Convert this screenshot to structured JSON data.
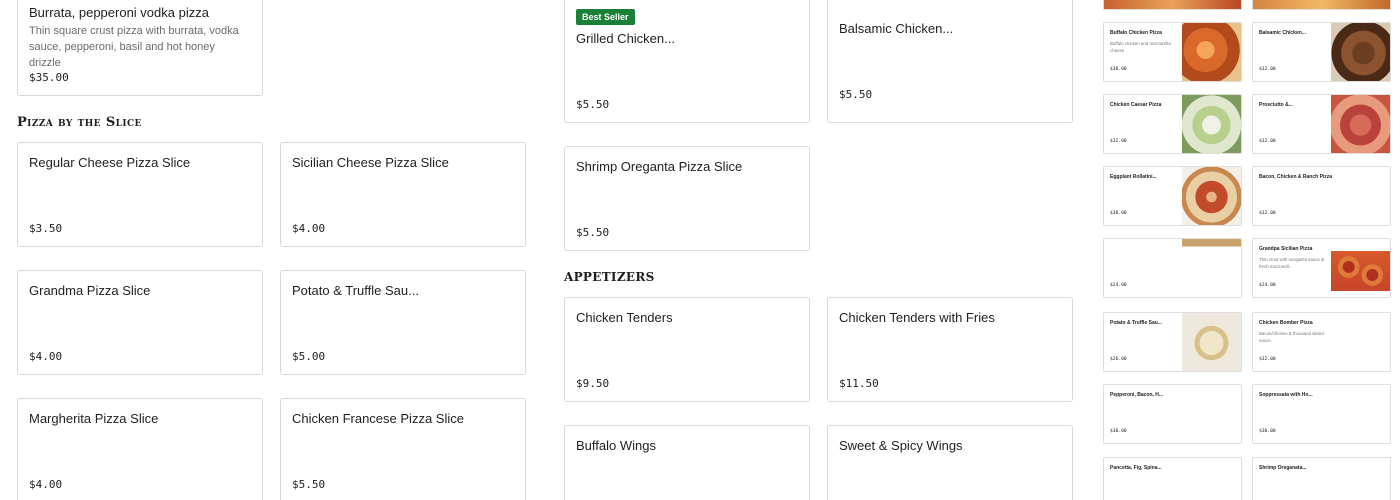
{
  "left_column": {
    "top_card": {
      "name": "Burrata, pepperoni vodka pizza",
      "description": "Thin square crust pizza with burrata, vodka sauce, pepperoni, basil and hot honey drizzle",
      "price": "$35.00"
    },
    "slice_section_title": "Pizza by the Slice",
    "slice_items": [
      {
        "name": "Regular Cheese Pizza Slice",
        "price": "$3.50"
      },
      {
        "name": "Sicilian Cheese Pizza Slice",
        "price": "$4.00"
      },
      {
        "name": "Grandma Pizza Slice",
        "price": "$4.00"
      },
      {
        "name": "Potato & Truffle Sau...",
        "price": "$5.00"
      },
      {
        "name": "Margherita Pizza Slice",
        "price": "$4.00"
      },
      {
        "name": "Chicken Francese Pizza Slice",
        "price": "$5.50"
      }
    ]
  },
  "middle_column": {
    "grilled_card": {
      "badge": "Best Seller",
      "name": "Grilled Chicken...",
      "price": "$5.50"
    },
    "balsamic_card": {
      "name": "Balsamic Chicken...",
      "price": "$5.50"
    },
    "shrimp_card": {
      "name": "Shrimp Oreganta Pizza Slice",
      "price": "$5.50"
    },
    "appetizers_title": "Appetizers",
    "appetizers": [
      {
        "name": "Chicken Tenders",
        "price": "$9.50"
      },
      {
        "name": "Chicken Tenders with Fries",
        "price": "$11.50"
      },
      {
        "name": "Buffalo Wings",
        "price": ""
      },
      {
        "name": "Sweet & Spicy Wings",
        "price": ""
      }
    ]
  },
  "right_column": {
    "items": [
      {
        "name": "Buffalo Chicken Pizza",
        "description": "Buffalo chicken and mozzarella cheese",
        "price": "$30.00",
        "thumb": "buffalo-chicken-pizza"
      },
      {
        "name": "Balsamic Chicken...",
        "description": "",
        "price": "$32.00",
        "thumb": "balsamic-chicken-pizza"
      },
      {
        "name": "Chicken Caesar Pizza",
        "description": "",
        "price": "$32.00",
        "thumb": "chicken-caesar-pizza"
      },
      {
        "name": "Prosciutto &...",
        "description": "",
        "price": "$32.00",
        "thumb": "prosciutto-pizza"
      },
      {
        "name": "Eggplant Rollatini...",
        "description": "",
        "price": "$30.00",
        "thumb": "eggplant-rollatini-pizza"
      },
      {
        "name": "Bacon, Chicken & Ranch Pizza",
        "description": "",
        "price": "$32.00",
        "thumb": ""
      },
      {
        "name": "",
        "description": "",
        "price": "$24.00",
        "thumb": "grandma-pizza"
      },
      {
        "name": "Grandpa Sicilian Pizza",
        "description": "Thin crust with margarita sauce & fresh mozzarell...",
        "price": "$24.00",
        "thumb": "grandpa-sicilian-pizza"
      },
      {
        "name": "Potato & Truffle Sau...",
        "description": "",
        "price": "$26.00",
        "thumb": "potato-truffle-slice"
      },
      {
        "name": "Chicken Bomber Pizza",
        "description": "Bacon/chicken & thousand island sauce.",
        "price": "$32.00",
        "thumb": ""
      },
      {
        "name": "Pepperoni, Bacon, H...",
        "description": "",
        "price": "$30.00",
        "thumb": ""
      },
      {
        "name": "Soppressata with Ho...",
        "description": "",
        "price": "$30.00",
        "thumb": ""
      },
      {
        "name": "Pancetta, Fig, Spina...",
        "description": "",
        "price": "",
        "thumb": ""
      },
      {
        "name": "Shrimp Oreganata...",
        "description": "",
        "price": "",
        "thumb": ""
      }
    ]
  },
  "colors": {
    "badge_green": "#1a7f37",
    "border": "#d9d9d9"
  }
}
